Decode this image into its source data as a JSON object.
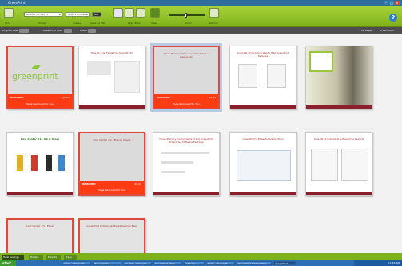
{
  "window": {
    "title": "GreenPrint"
  },
  "ribbon": {
    "print_label": "Print",
    "printer_select": "Brother MFC-9770",
    "paper_select": "8.5x11 Portrait",
    "go_label": "Go",
    "labels": [
      "Printer",
      "Copies",
      "Save As PDF",
      "Page Tools",
      "View",
      "Zoom",
      "Options"
    ],
    "help_icon": "help-icon"
  },
  "status": {
    "original_label": "Original Cost",
    "greenprint_label": "GreenPrint Cost",
    "saved_label": "Saved",
    "pages_label": "11 Pages",
    "removed_label": "2 Removed"
  },
  "slides": [
    {
      "title": "",
      "removed": true,
      "removed_label": "REMOVED",
      "cost": "$0.04",
      "note": "Page Removed for You",
      "logo": "greenprint"
    },
    {
      "title": "How Do Law Firms Use GreenPrint?",
      "removed": false
    },
    {
      "title": "Three Primary Ways GreenPrint Saves Resources",
      "removed": true,
      "removed_label": "REMOVED",
      "cost": "$0.04",
      "note": "Page Removed for You",
      "selected": true
    },
    {
      "title": "Example of Common Waste that GreenPrint Reduces",
      "removed": false
    },
    {
      "title": "",
      "removed": false,
      "photo": true
    },
    {
      "title": "Cost Center #1 - Ink & Toner",
      "removed": false
    },
    {
      "title": "Cost Center #2 - Energy Usage",
      "removed": true,
      "removed_label": "REMOVED",
      "cost": "$0.04",
      "note": "Page Removed for You"
    },
    {
      "title": "Three Primary Components of the GreenPrint Enterprise Software Package",
      "removed": false
    },
    {
      "title": "GreenPrint's Powerful Admin Tools",
      "removed": false
    },
    {
      "title": "GreenPrint Individual & Executive Reports",
      "removed": false
    },
    {
      "title": "Cost Center #3 - Paper",
      "removed": true,
      "removed_label": "",
      "cost": "",
      "note": ""
    },
    {
      "title": "GreenPrint Enterprise Makes Savings Easy",
      "removed": true,
      "removed_label": "",
      "cost": "",
      "note": ""
    }
  ],
  "taskbar": {
    "tabs": [
      "Total Savings",
      "Dollars",
      "Pounds",
      "Trees"
    ],
    "start_label": "start",
    "tasks": [
      "Inbox - Microsoft",
      "Document2 - Microsoft",
      "Gp Trial - Notepad",
      "GreenPrint Stats",
      "A Folder",
      "Stats - Microsoft",
      "GreenPrint Presentation",
      "GreenPrint"
    ],
    "clock": "11:43 AM"
  }
}
